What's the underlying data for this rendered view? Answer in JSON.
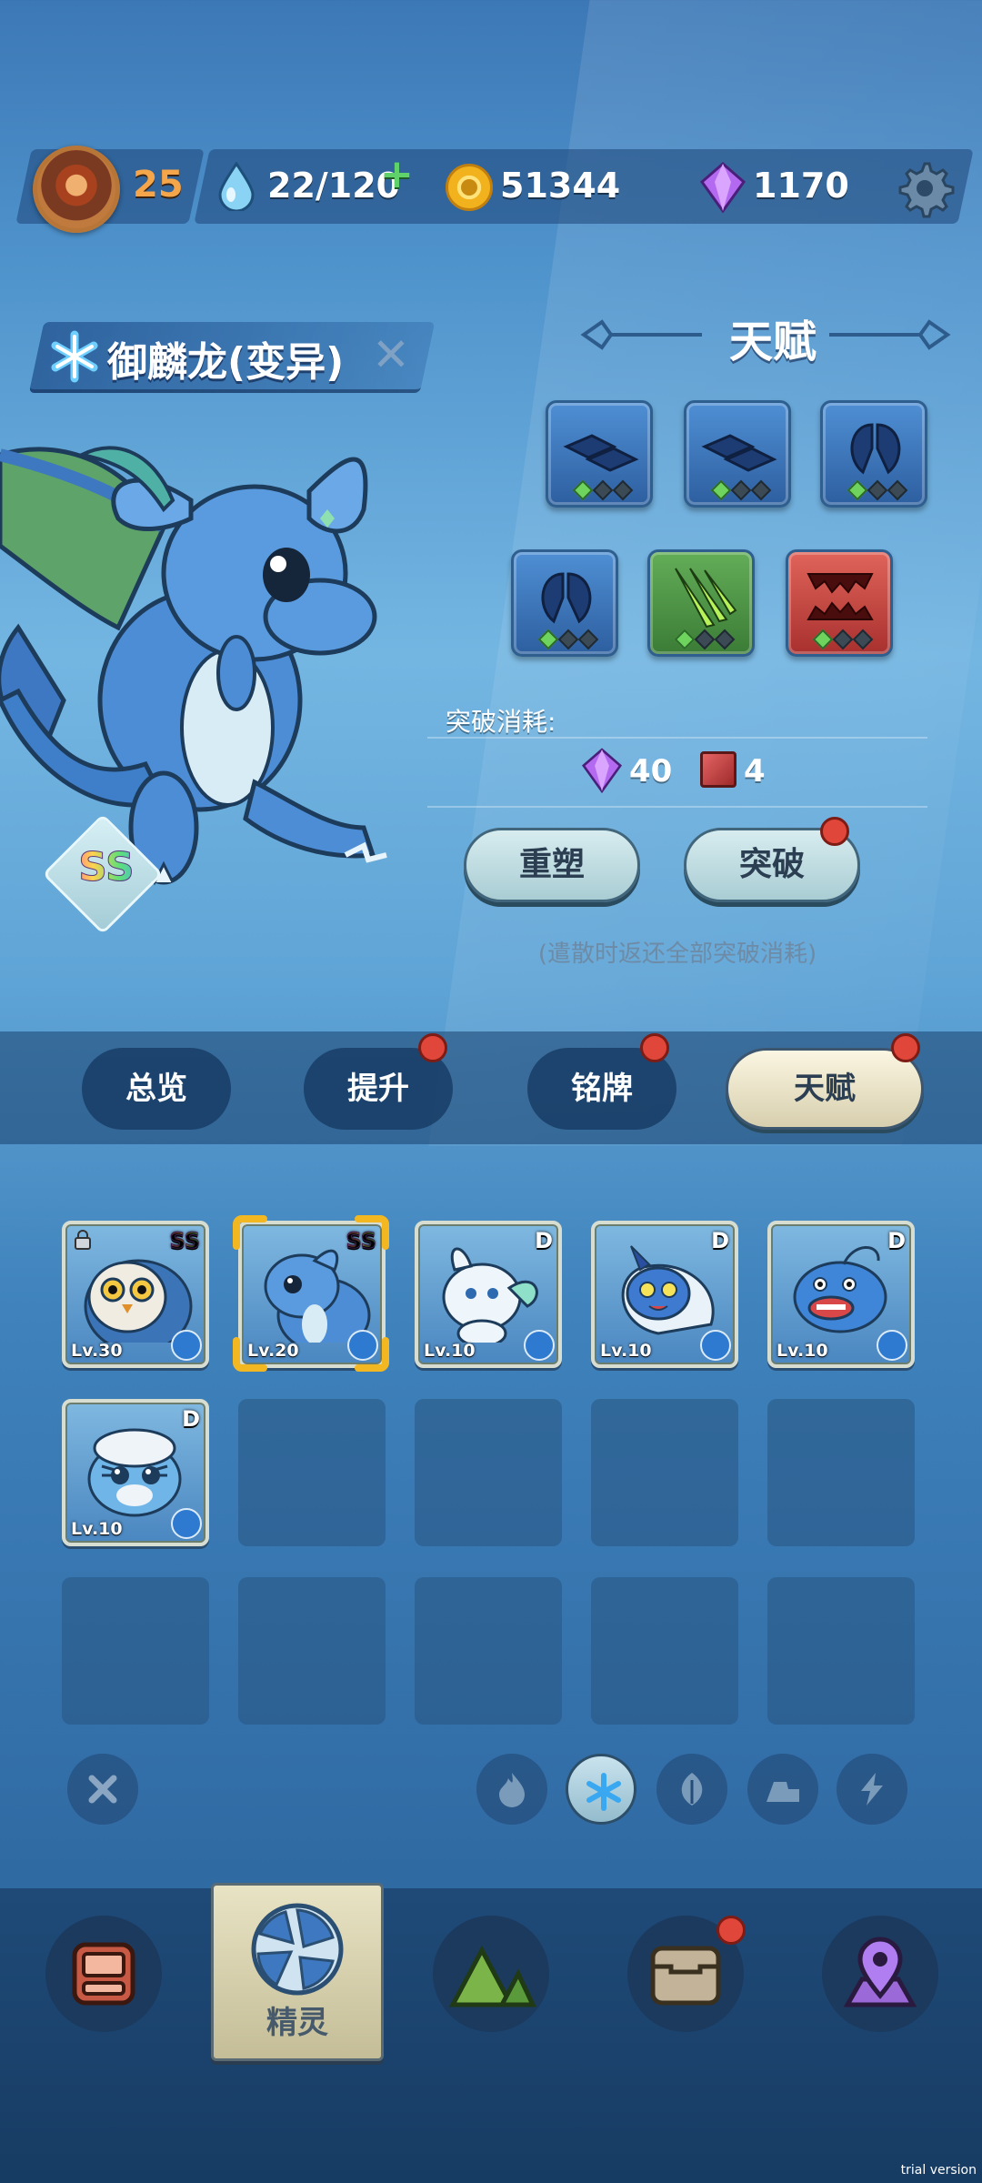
{
  "status_bar": {
    "level": "25",
    "stamina": "22/120",
    "coins": "51344",
    "gems": "1170"
  },
  "pet": {
    "name": "御麟龙(变异)",
    "grade": "SS",
    "element": "snowflake-icon"
  },
  "talent": {
    "title": "天赋",
    "slots": [
      {
        "icon": "tiles-icon",
        "color": "#3d74b8",
        "stars": 1
      },
      {
        "icon": "tiles-icon",
        "color": "#3d74b8",
        "stars": 1
      },
      {
        "icon": "leaf-split-icon",
        "color": "#3d74b8",
        "stars": 1
      },
      {
        "icon": "leaf-split-icon",
        "color": "#3d74b8",
        "stars": 1
      },
      {
        "icon": "claw-slash-icon",
        "color": "#4f9746",
        "stars": 1
      },
      {
        "icon": "fangs-icon",
        "color": "#c2433c",
        "stars": 1
      }
    ],
    "cost_label": "突破消耗:",
    "cost_gems": "40",
    "cost_books": "4",
    "reshape_label": "重塑",
    "breakthrough_label": "突破",
    "note": "(遣散时返还全部突破消耗)"
  },
  "tabs": [
    {
      "label": "总览",
      "badge": false
    },
    {
      "label": "提升",
      "badge": true
    },
    {
      "label": "铭牌",
      "badge": true
    },
    {
      "label": "天赋",
      "badge": true,
      "active": true
    }
  ],
  "pets": [
    {
      "level": "Lv.30",
      "grade": "SS",
      "locked": true,
      "art": "owl",
      "element": "snowflake-icon"
    },
    {
      "level": "Lv.20",
      "grade": "SS",
      "selected": true,
      "art": "dragon",
      "element": "snowflake-icon"
    },
    {
      "level": "Lv.10",
      "grade": "D",
      "art": "white-beast",
      "element": "snowflake-icon"
    },
    {
      "level": "Lv.10",
      "grade": "D",
      "art": "blue-cat",
      "element": "snowflake-icon"
    },
    {
      "level": "Lv.10",
      "grade": "D",
      "art": "fish",
      "element": "snowflake-icon"
    },
    {
      "level": "Lv.10",
      "grade": "D",
      "art": "tiger-cub",
      "element": "snowflake-icon"
    }
  ],
  "filters": [
    "close-icon",
    "fire-icon",
    "snowflake-icon",
    "leaf-icon",
    "rock-icon",
    "lightning-icon"
  ],
  "nav": {
    "items": [
      "backpack-icon",
      "spirit-icon",
      "mountain-icon",
      "chest-icon",
      "map-pin-icon"
    ],
    "active_label": "精灵"
  },
  "watermark": "trial version",
  "colors": {
    "accent_gold": "#f5a54a",
    "badge_red": "#e0473a",
    "gem_purple": "#9a4fe0"
  }
}
